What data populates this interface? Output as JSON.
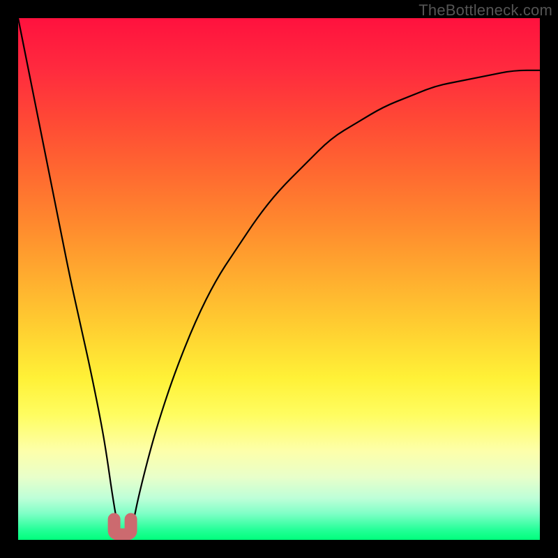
{
  "watermark": "TheBottleneck.com",
  "colors": {
    "frame": "#000000",
    "curve": "#000000",
    "marker_fill": "#cc6a6f",
    "marker_stroke": "#cc6a6f",
    "watermark_text": "#555555",
    "gradient_top": "#ff113e",
    "gradient_bottom": "#00ff7c"
  },
  "chart_data": {
    "type": "line",
    "title": "",
    "xlabel": "",
    "ylabel": "",
    "xlim": [
      0,
      100
    ],
    "ylim": [
      0,
      100
    ],
    "grid": false,
    "x": [
      0,
      2,
      4,
      6,
      8,
      10,
      12,
      14,
      16,
      17,
      18,
      19,
      20,
      21,
      22,
      23,
      25,
      27,
      30,
      34,
      38,
      42,
      46,
      50,
      55,
      60,
      65,
      70,
      75,
      80,
      85,
      90,
      95,
      100
    ],
    "values": [
      100,
      90,
      80,
      70,
      60,
      50,
      41,
      32,
      22,
      16,
      9,
      3,
      0,
      0,
      3,
      8,
      16,
      23,
      32,
      42,
      50,
      56,
      62,
      67,
      72,
      77,
      80,
      83,
      85,
      87,
      88,
      89,
      90,
      90
    ],
    "annotations": [
      {
        "label": "optimal-region",
        "x": 20,
        "y": 1
      }
    ],
    "background_scale": {
      "orientation": "vertical",
      "description": "bottleneck severity gradient",
      "stops": [
        {
          "y": 100,
          "color": "#ff113e"
        },
        {
          "y": 50,
          "color": "#ffae2f"
        },
        {
          "y": 30,
          "color": "#fff137"
        },
        {
          "y": 10,
          "color": "#beffd8"
        },
        {
          "y": 0,
          "color": "#00ff7c"
        }
      ]
    }
  }
}
